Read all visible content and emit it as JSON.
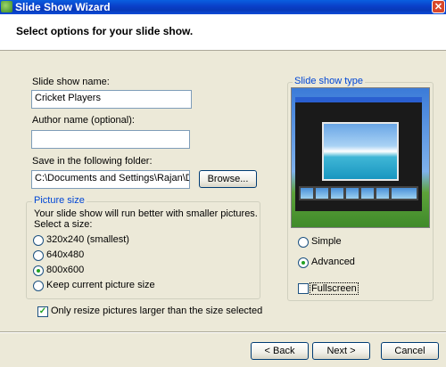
{
  "window": {
    "title": "Slide Show Wizard",
    "close_glyph": "✕"
  },
  "header": {
    "text": "Select options for your slide show."
  },
  "form": {
    "name_label": "Slide show name:",
    "name_value": "Cricket Players",
    "author_label": "Author name (optional):",
    "author_value": "",
    "folder_label": "Save in the following folder:",
    "folder_value": "C:\\Documents and Settings\\Rajan\\Des",
    "browse_label": "Browse..."
  },
  "picture_size": {
    "title": "Picture size",
    "hint": "Your slide show will run better with smaller pictures.",
    "prompt": "Select a size:",
    "options": [
      "320x240 (smallest)",
      "640x480",
      "800x600",
      "Keep current picture size"
    ],
    "selected": "800x600"
  },
  "resize_only_larger": {
    "label": "Only resize pictures larger than the size selected",
    "checked": true
  },
  "slide_show_type": {
    "title": "Slide show type",
    "options": [
      "Simple",
      "Advanced"
    ],
    "selected": "Advanced",
    "fullscreen_label": "Fullscreen",
    "fullscreen_checked": false
  },
  "buttons": {
    "back": "< Back",
    "next": "Next >",
    "cancel": "Cancel"
  }
}
